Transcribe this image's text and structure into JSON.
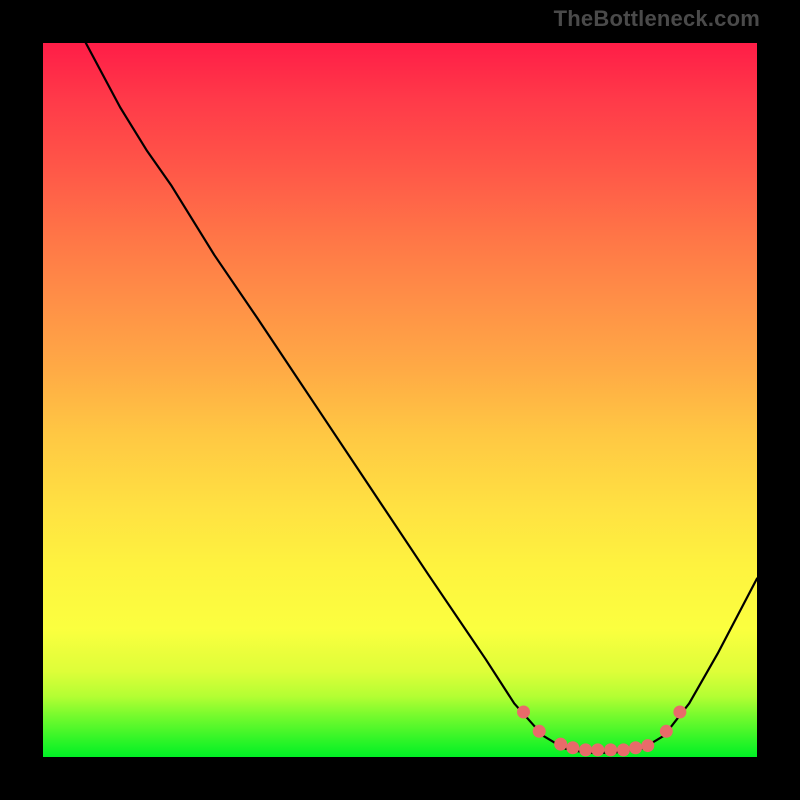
{
  "watermark": "TheBottleneck.com",
  "chart_data": {
    "type": "line",
    "title": "",
    "xlabel": "",
    "ylabel": "",
    "xlim": [
      0,
      100
    ],
    "ylim": [
      0,
      100
    ],
    "series": [
      {
        "name": "curve",
        "color": "#000000",
        "points": [
          {
            "x": 6.0,
            "y": 100.0
          },
          {
            "x": 10.8,
            "y": 91.0
          },
          {
            "x": 14.5,
            "y": 85.0
          },
          {
            "x": 18.0,
            "y": 80.0
          },
          {
            "x": 24.0,
            "y": 70.3
          },
          {
            "x": 30.0,
            "y": 61.5
          },
          {
            "x": 38.0,
            "y": 49.5
          },
          {
            "x": 46.0,
            "y": 37.5
          },
          {
            "x": 54.0,
            "y": 25.5
          },
          {
            "x": 62.0,
            "y": 13.7
          },
          {
            "x": 66.0,
            "y": 7.5
          },
          {
            "x": 70.0,
            "y": 3.0
          },
          {
            "x": 73.0,
            "y": 1.2
          },
          {
            "x": 76.0,
            "y": 0.6
          },
          {
            "x": 80.0,
            "y": 0.6
          },
          {
            "x": 84.0,
            "y": 1.2
          },
          {
            "x": 87.0,
            "y": 3.0
          },
          {
            "x": 90.5,
            "y": 7.5
          },
          {
            "x": 94.5,
            "y": 14.5
          },
          {
            "x": 100.0,
            "y": 25.0
          }
        ]
      },
      {
        "name": "highlight-dots",
        "color": "#e86b6a",
        "points": [
          {
            "x": 67.3,
            "y": 6.3
          },
          {
            "x": 69.5,
            "y": 3.6
          },
          {
            "x": 72.5,
            "y": 1.8
          },
          {
            "x": 74.2,
            "y": 1.3
          },
          {
            "x": 76.0,
            "y": 1.0
          },
          {
            "x": 77.7,
            "y": 1.0
          },
          {
            "x": 79.5,
            "y": 1.0
          },
          {
            "x": 81.3,
            "y": 1.0
          },
          {
            "x": 83.0,
            "y": 1.3
          },
          {
            "x": 84.7,
            "y": 1.6
          },
          {
            "x": 87.3,
            "y": 3.6
          },
          {
            "x": 89.2,
            "y": 6.3
          }
        ]
      }
    ],
    "gradient_stops": [
      {
        "pos": 0.0,
        "color": "#ff1d47"
      },
      {
        "pos": 0.5,
        "color": "#ffb044"
      },
      {
        "pos": 0.85,
        "color": "#fbff3f"
      },
      {
        "pos": 1.0,
        "color": "#00f025"
      }
    ]
  }
}
